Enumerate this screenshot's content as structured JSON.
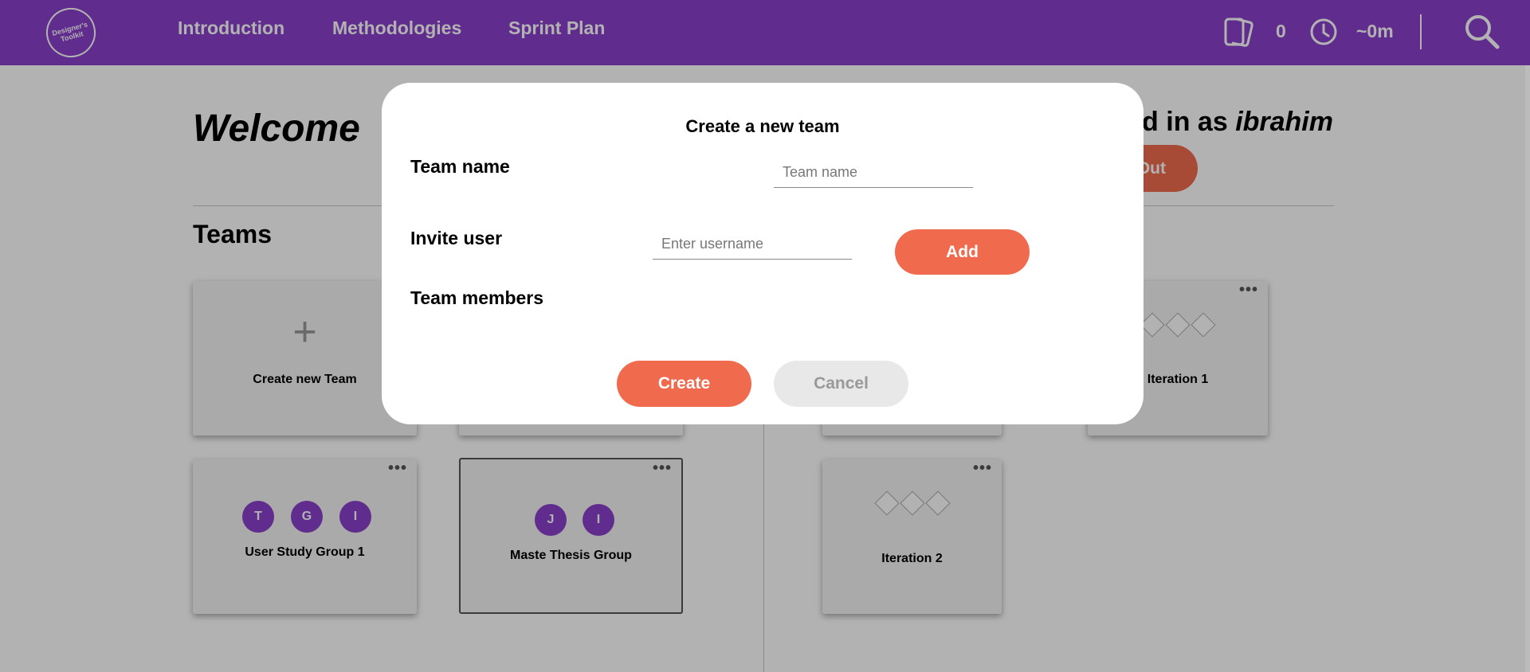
{
  "navbar": {
    "logo_text": "Designer's Toolkit",
    "links": [
      "Introduction",
      "Methodologies",
      "Sprint Plan"
    ],
    "cards_count": "0",
    "time": "~0m",
    "colors": {
      "brand": "#8a40cc",
      "accent": "#f06b4e"
    }
  },
  "page": {
    "welcome": "Welcome",
    "logged_in_prefix": "d in as ",
    "username": "ibrahim",
    "logout_label": "Out",
    "teams_title": "Teams"
  },
  "teams": {
    "create_label": "Create new Team",
    "cards": [
      {
        "name": "User Study Group 1",
        "members": [
          "T",
          "G",
          "I"
        ]
      },
      {
        "name": "Maste Thesis Group",
        "members": [
          "J",
          "I"
        ]
      }
    ]
  },
  "iterations": {
    "cards": [
      {
        "name": "Iteration 1"
      },
      {
        "name": "Iteration 2"
      }
    ]
  },
  "modal": {
    "title": "Create a new team",
    "team_name_label": "Team name",
    "team_name_placeholder": "Team name",
    "invite_label": "Invite user",
    "username_placeholder": "Enter username",
    "add_label": "Add",
    "members_label": "Team members",
    "create_label": "Create",
    "cancel_label": "Cancel"
  }
}
